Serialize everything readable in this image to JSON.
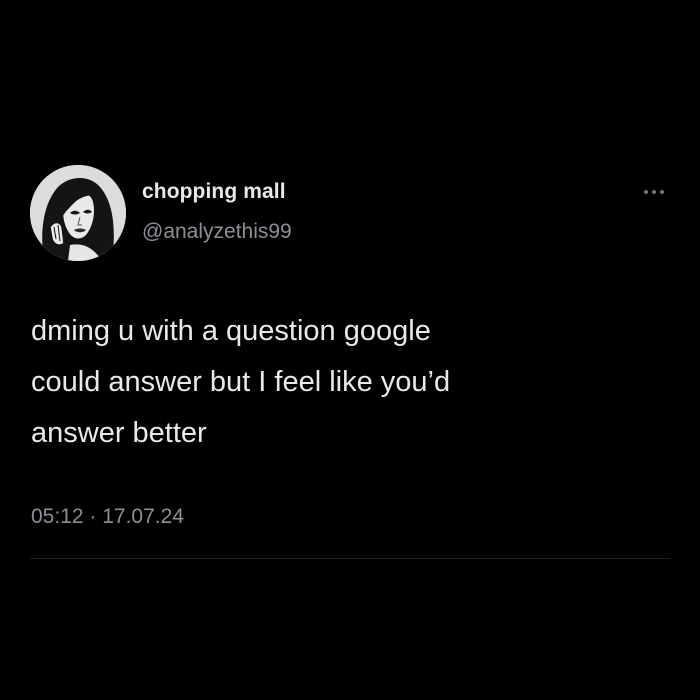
{
  "tweet": {
    "author": {
      "display_name": "chopping mall",
      "handle": "@analyzethis99",
      "avatar_icon": "avatar-illustration"
    },
    "text": "dming u with a question google\ncould answer but I feel like you’d\nanswer better",
    "timestamp": "05:12 · 17.07.24",
    "more_icon": "more-options-icon"
  },
  "colors": {
    "background": "#000000",
    "primary_text": "#e7e9ea",
    "secondary_text": "#8b9096",
    "divider": "#1c1f23"
  }
}
